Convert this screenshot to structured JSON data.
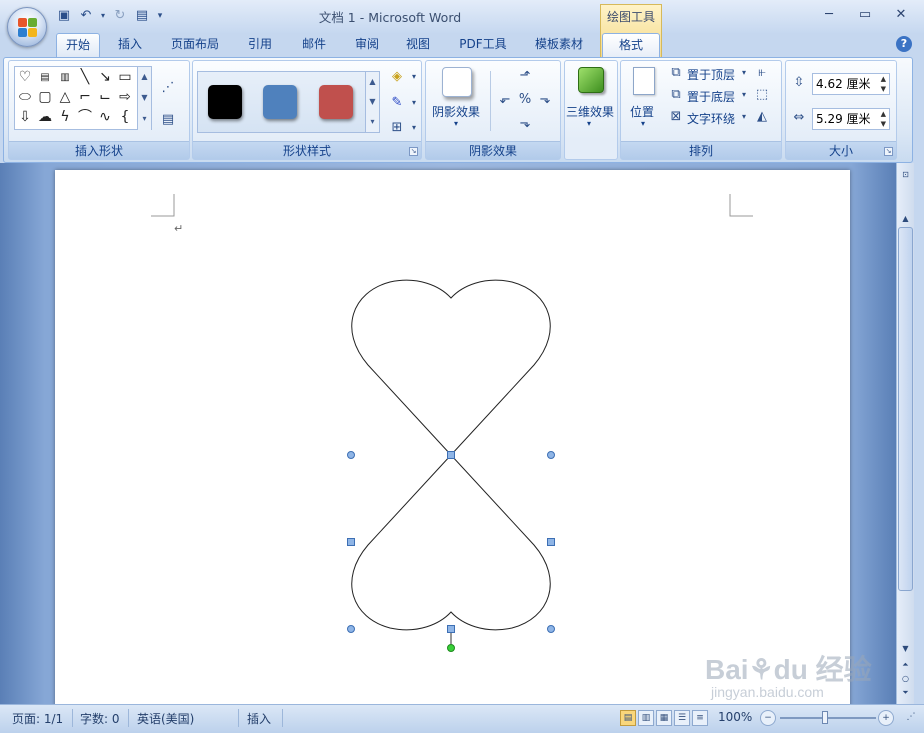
{
  "window": {
    "title": "文档 1 - Microsoft Word",
    "controls": [
      "─",
      "▭",
      "✕"
    ]
  },
  "quick_access": {
    "icons": [
      "save-icon",
      "undo-icon",
      "redo-icon",
      "print-preview-icon"
    ]
  },
  "context_tab": {
    "label": "绘图工具"
  },
  "tabs": [
    "开始",
    "插入",
    "页面布局",
    "引用",
    "邮件",
    "审阅",
    "视图",
    "PDF工具",
    "模板素材",
    "格式"
  ],
  "active_tab": "格式",
  "ribbon": {
    "insert_shapes": {
      "label": "插入形状"
    },
    "shape_styles": {
      "label": "形状样式",
      "swatches": [
        "#000000",
        "#4f81bd",
        "#c0504d"
      ]
    },
    "shadow_effects": {
      "label": "阴影效果",
      "button": "阴影效果"
    },
    "three_d": {
      "button": "三维效果"
    },
    "arrange": {
      "label": "排列",
      "position": "位置",
      "bring_front": "置于顶层",
      "send_back": "置于底层",
      "text_wrap": "文字环绕"
    },
    "size": {
      "label": "大小",
      "height": "4.62 厘米",
      "width": "5.29 厘米"
    }
  },
  "statusbar": {
    "page": "页面: 1/1",
    "words": "字数: 0",
    "language": "英语(美国)",
    "mode": "插入",
    "zoom": "100%"
  },
  "watermark": {
    "url": "jingyan.baidu.com"
  }
}
